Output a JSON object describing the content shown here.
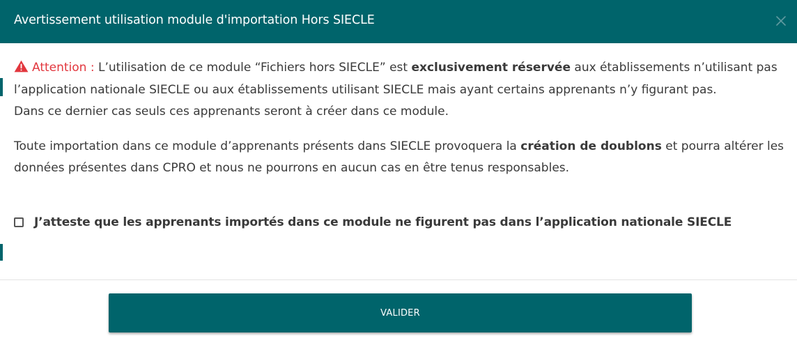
{
  "dialog": {
    "title": "Avertissement utilisation module d'importation Hors SIECLE",
    "close_icon": "close-icon"
  },
  "warning": {
    "icon": "warning-triangle-icon",
    "label": "Attention :",
    "p1_line1_a": " L’utilisation de ce module “Fichiers hors SIECLE” est ",
    "p1_line1_bold": "exclusivement réservée",
    "p1_line1_b": " aux établissements n’utilisant pas",
    "p1_line2": "l’application nationale SIECLE ou aux établissements utilisant SIECLE mais ayant certains apprenants n’y figurant pas.",
    "p1_line3": "Dans ce dernier cas seuls ces apprenants seront à créer dans ce module.",
    "p2_line1_a": "Toute importation dans ce module d’apprenants présents dans SIECLE provoquera la ",
    "p2_line1_bold": "création de doublons",
    "p2_line1_b": " et pourra altérer les",
    "p2_line2": "données présentes dans CPRO et nous ne pourrons en aucun cas en être tenus responsables."
  },
  "attestation": {
    "label": "J’atteste que les apprenants importés dans ce module ne figurent pas dans l’application nationale SIECLE",
    "checked": false
  },
  "footer": {
    "validate_label": "VALIDER"
  },
  "colors": {
    "primary": "#00646b",
    "alert": "#e2373e",
    "text": "#3a3a3a"
  }
}
